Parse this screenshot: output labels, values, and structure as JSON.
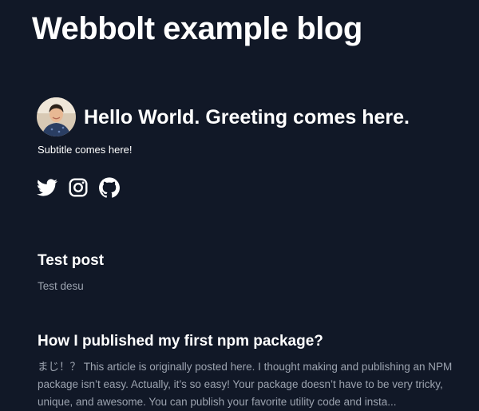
{
  "site": {
    "title": "Webbolt example blog"
  },
  "hero": {
    "greeting": "Hello World. Greeting comes here.",
    "subtitle": "Subtitle comes here!",
    "avatar_alt": "author-avatar"
  },
  "social": [
    {
      "name": "twitter",
      "icon": "twitter-icon"
    },
    {
      "name": "instagram",
      "icon": "instagram-icon"
    },
    {
      "name": "github",
      "icon": "github-icon"
    }
  ],
  "posts": [
    {
      "title": "Test post",
      "excerpt": "Test desu"
    },
    {
      "title": "How I published my first npm package?",
      "excerpt": "まじ！？ This article is originally posted here. I thought making and publishing an NPM package isn’t easy. Actually, it’s so easy! Your package doesn’t have to be very tricky, unique, and awesome. You can publish your favorite utility code and insta..."
    }
  ],
  "colors": {
    "background": "#111827",
    "text": "#ffffff",
    "muted": "#9ca3af"
  }
}
